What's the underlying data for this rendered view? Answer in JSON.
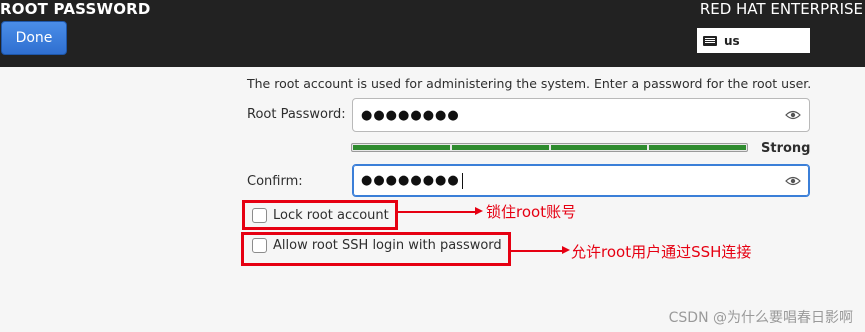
{
  "header": {
    "title": "ROOT PASSWORD",
    "done_label": "Done",
    "product": "RED HAT ENTERPRISE",
    "keyboard_layout": "us"
  },
  "form": {
    "description": "The root account is used for administering the system.  Enter a password for the root user.",
    "root_password_label": "Root Password:",
    "root_password_masked": "●●●●●●●●",
    "strength_label": "Strong",
    "confirm_label": "Confirm:",
    "confirm_masked": "●●●●●●●●",
    "lock_root_label": "Lock root account",
    "lock_root_checked": false,
    "allow_ssh_label": "Allow root SSH login with password",
    "allow_ssh_checked": false
  },
  "annotations": {
    "lock_note": "锁住root账号",
    "ssh_note": "允许root用户通过SSH连接",
    "color": "#e60012"
  },
  "watermark": "CSDN @为什么要唱春日影啊"
}
